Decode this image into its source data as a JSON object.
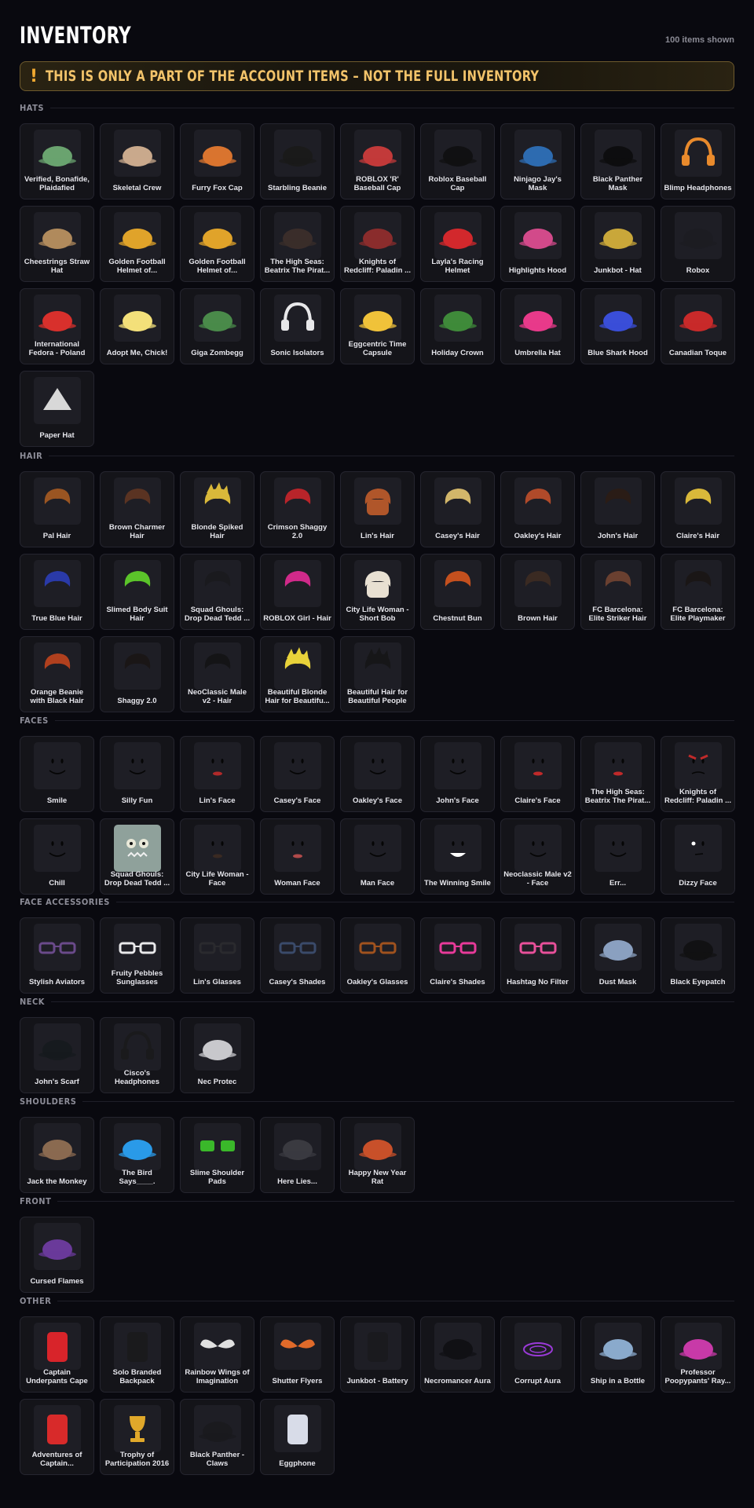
{
  "page": {
    "title": "INVENTORY",
    "items_count": "100 items shown"
  },
  "banner": {
    "icon": "exclamation-icon",
    "icon_glyph": "!",
    "text": "THIS IS ONLY A PART OF THE ACCOUNT ITEMS – NOT THE FULL INVENTORY"
  },
  "colors": {
    "background": "#09090f",
    "card": "#141419",
    "banner_border": "#6e5a2d",
    "banner_text": "#f2c36a",
    "banner_icon": "#f0a830"
  },
  "sections": [
    {
      "id": "hats",
      "title": "HATS",
      "items": [
        {
          "label": "Verified, Bonafide, Plaidafied",
          "icon": "plaid-cap-icon",
          "color": "#6aa36f"
        },
        {
          "label": "Skeletal Crew",
          "icon": "skull-icon",
          "color": "#c9a98c"
        },
        {
          "label": "Furry Fox Cap",
          "icon": "fox-cap-icon",
          "color": "#d9742f"
        },
        {
          "label": "Starbling Beanie",
          "icon": "beanie-icon",
          "color": "#1a1a1a"
        },
        {
          "label": "ROBLOX 'R' Baseball Cap",
          "icon": "cap-icon",
          "color": "#c23a3a"
        },
        {
          "label": "Roblox Baseball Cap",
          "icon": "cap-icon",
          "color": "#101012"
        },
        {
          "label": "Ninjago Jay's Mask",
          "icon": "mask-icon",
          "color": "#2d6bb0"
        },
        {
          "label": "Black Panther Mask",
          "icon": "mask-icon",
          "color": "#0d0d0f"
        },
        {
          "label": "Blimp Headphones",
          "icon": "headphones-icon",
          "color": "#e98a2c"
        },
        {
          "label": "Cheestrings Straw Hat",
          "icon": "straw-hat-icon",
          "color": "#b08a5c"
        },
        {
          "label": "Golden Football Helmet of...",
          "icon": "helmet-icon",
          "color": "#e0a32a"
        },
        {
          "label": "Golden Football Helmet of...",
          "icon": "helmet-icon",
          "color": "#e0a32a"
        },
        {
          "label": "The High Seas: Beatrix The Pirat...",
          "icon": "pirate-hat-icon",
          "color": "#3a2d2a"
        },
        {
          "label": "Knights of Redcliff: Paladin ...",
          "icon": "knight-helmet-icon",
          "color": "#8a2c2c"
        },
        {
          "label": "Layla's Racing Helmet",
          "icon": "racing-helmet-icon",
          "color": "#d2282c"
        },
        {
          "label": "Highlights Hood",
          "icon": "hood-icon",
          "color": "#d24a8a"
        },
        {
          "label": "Junkbot - Hat",
          "icon": "junkbot-hat-icon",
          "color": "#c9a73a"
        },
        {
          "label": "Robox",
          "icon": "robox-icon",
          "color": "#1c1c22"
        },
        {
          "label": "International Fedora - Poland",
          "icon": "fedora-icon",
          "color": "#d8302c"
        },
        {
          "label": "Adopt Me, Chick!",
          "icon": "chick-icon",
          "color": "#f3e07a"
        },
        {
          "label": "Giga Zombegg",
          "icon": "zombie-egg-icon",
          "color": "#4a8a4a"
        },
        {
          "label": "Sonic Isolators",
          "icon": "headphones-icon",
          "color": "#e8e8ea"
        },
        {
          "label": "Eggcentric Time Capsule",
          "icon": "egg-capsule-icon",
          "color": "#f0c23a"
        },
        {
          "label": "Holiday Crown",
          "icon": "wreath-icon",
          "color": "#3f8a3a"
        },
        {
          "label": "Umbrella Hat",
          "icon": "umbrella-hat-icon",
          "color": "#e83a8a"
        },
        {
          "label": "Blue Shark Hood",
          "icon": "shark-hood-icon",
          "color": "#3a4ed8"
        },
        {
          "label": "Canadian Toque",
          "icon": "toque-icon",
          "color": "#c82a2a"
        },
        {
          "label": "Paper Hat",
          "icon": "paper-hat-icon",
          "color": "#d8d8d8"
        }
      ]
    },
    {
      "id": "hair",
      "title": "HAIR",
      "items": [
        {
          "label": "Pal Hair",
          "icon": "hair-icon",
          "color": "#9a5522"
        },
        {
          "label": "Brown Charmer Hair",
          "icon": "hair-icon",
          "color": "#5a3322"
        },
        {
          "label": "Blonde Spiked Hair",
          "icon": "spiky-hair-icon",
          "color": "#d9b83a"
        },
        {
          "label": "Crimson Shaggy 2.0",
          "icon": "hair-icon",
          "color": "#b8242a"
        },
        {
          "label": "Lin's Hair",
          "icon": "long-hair-icon",
          "color": "#b0562a"
        },
        {
          "label": "Casey's Hair",
          "icon": "hair-icon",
          "color": "#d2b66a"
        },
        {
          "label": "Oakley's Hair",
          "icon": "hair-icon",
          "color": "#b04a2a"
        },
        {
          "label": "John's Hair",
          "icon": "hair-icon",
          "color": "#2a1c16"
        },
        {
          "label": "Claire's Hair",
          "icon": "ponytail-hair-icon",
          "color": "#d9b83a"
        },
        {
          "label": "True Blue Hair",
          "icon": "hair-icon",
          "color": "#2a3aa8"
        },
        {
          "label": "Slimed Body Suit Hair",
          "icon": "slime-hair-icon",
          "color": "#5bc42a"
        },
        {
          "label": "Squad Ghouls: Drop Dead Tedd ...",
          "icon": "hair-icon",
          "color": "#1a1a1e"
        },
        {
          "label": "ROBLOX Girl - Hair",
          "icon": "pigtail-hair-icon",
          "color": "#d02a8a"
        },
        {
          "label": "City Life Woman - Short Bob",
          "icon": "bob-hair-icon",
          "color": "#e8e0d2"
        },
        {
          "label": "Chestnut Bun",
          "icon": "bun-hair-icon",
          "color": "#c4501e"
        },
        {
          "label": "Brown Hair",
          "icon": "hair-icon",
          "color": "#3a2a22"
        },
        {
          "label": "FC Barcelona: Elite Striker Hair",
          "icon": "hair-icon",
          "color": "#6a4030"
        },
        {
          "label": "FC Barcelona: Elite Playmaker Hair",
          "icon": "hair-icon",
          "color": "#1a1616"
        },
        {
          "label": "Orange Beanie with Black Hair",
          "icon": "beanie-hair-icon",
          "color": "#b0401e"
        },
        {
          "label": "Shaggy 2.0",
          "icon": "hair-icon",
          "color": "#1a1616"
        },
        {
          "label": "NeoClassic Male v2 - Hair",
          "icon": "hair-icon",
          "color": "#141416"
        },
        {
          "label": "Beautiful Blonde Hair for Beautifu...",
          "icon": "spiky-hair-icon",
          "color": "#e8d23a"
        },
        {
          "label": "Beautiful Hair for Beautiful People",
          "icon": "spiky-hair-icon",
          "color": "#161618"
        }
      ]
    },
    {
      "id": "faces",
      "title": "FACES",
      "items": [
        {
          "label": "Smile",
          "icon": "smile-face-icon",
          "color": "#0a0a0a"
        },
        {
          "label": "Silly Fun",
          "icon": "silly-face-icon",
          "color": "#0a0a0a"
        },
        {
          "label": "Lin's Face",
          "icon": "lips-face-icon",
          "color": "#b02a2a"
        },
        {
          "label": "Casey's Face",
          "icon": "smirk-face-icon",
          "color": "#0a0a0a"
        },
        {
          "label": "Oakley's Face",
          "icon": "smirk-face-icon",
          "color": "#0a0a0a"
        },
        {
          "label": "John's Face",
          "icon": "smirk-face-icon",
          "color": "#0a0a0a"
        },
        {
          "label": "Claire's Face",
          "icon": "lips-face-icon",
          "color": "#c02a2a"
        },
        {
          "label": "The High Seas: Beatrix The Pirat...",
          "icon": "lips-face-icon",
          "color": "#c02a2a"
        },
        {
          "label": "Knights of Redcliff: Paladin ...",
          "icon": "angry-face-icon",
          "color": "#c02a2a"
        },
        {
          "label": "Chill",
          "icon": "chill-face-icon",
          "color": "#0a0a0a"
        },
        {
          "label": "Squad Ghouls: Drop Dead Tedd ...",
          "icon": "ghoul-face-icon",
          "color": "#2a3a2a"
        },
        {
          "label": "City Life Woman - Face",
          "icon": "woman-face-icon",
          "color": "#3a2a22"
        },
        {
          "label": "Woman Face",
          "icon": "woman-face-icon",
          "color": "#b04a4a"
        },
        {
          "label": "Man Face",
          "icon": "man-face-icon",
          "color": "#0a0a0a"
        },
        {
          "label": "The Winning Smile",
          "icon": "grin-face-icon",
          "color": "#ffffff"
        },
        {
          "label": "Neoclassic Male v2 - Face",
          "icon": "man-face-icon",
          "color": "#3a2a1a"
        },
        {
          "label": "Err...",
          "icon": "err-face-icon",
          "color": "#0a0a0a"
        },
        {
          "label": "Dizzy Face",
          "icon": "dizzy-face-icon",
          "color": "#ffffff"
        }
      ]
    },
    {
      "id": "face_accessories",
      "title": "FACE ACCESSORIES",
      "items": [
        {
          "label": "Stylish Aviators",
          "icon": "aviator-glasses-icon",
          "color": "#6a4a8a"
        },
        {
          "label": "Fruity Pebbles Sunglasses",
          "icon": "sunglasses-icon",
          "color": "#e8e8ea"
        },
        {
          "label": "Lin's Glasses",
          "icon": "glasses-icon",
          "color": "#2a2a2e"
        },
        {
          "label": "Casey's Shades",
          "icon": "sunglasses-icon",
          "color": "#3a4a6a"
        },
        {
          "label": "Oakley's Glasses",
          "icon": "glasses-icon",
          "color": "#a0521e"
        },
        {
          "label": "Claire's Shades",
          "icon": "sunglasses-icon",
          "color": "#e83a9a"
        },
        {
          "label": "Hashtag No Filter",
          "icon": "visor-glasses-icon",
          "color": "#e8509a"
        },
        {
          "label": "Dust Mask",
          "icon": "dust-mask-icon",
          "color": "#8aa0c0"
        },
        {
          "label": "Black Eyepatch",
          "icon": "eyepatch-icon",
          "color": "#111113"
        }
      ]
    },
    {
      "id": "neck",
      "title": "NECK",
      "items": [
        {
          "label": "John's Scarf",
          "icon": "scarf-icon",
          "color": "#161a1e"
        },
        {
          "label": "Cisco's Headphones",
          "icon": "headphones-icon",
          "color": "#1a1a1c"
        },
        {
          "label": "Nec Protec",
          "icon": "neck-pillow-icon",
          "color": "#c8c8cc"
        }
      ]
    },
    {
      "id": "shoulders",
      "title": "SHOULDERS",
      "items": [
        {
          "label": "Jack the Monkey",
          "icon": "monkey-icon",
          "color": "#8a6a50"
        },
        {
          "label": "The Bird Says____.",
          "icon": "bird-icon",
          "color": "#2a9ae8"
        },
        {
          "label": "Slime Shoulder Pads",
          "icon": "slime-pads-icon",
          "color": "#3ab82a"
        },
        {
          "label": "Here Lies...",
          "icon": "tombstone-icon",
          "color": "#3a3a40"
        },
        {
          "label": "Happy New Year Rat",
          "icon": "rat-icon",
          "color": "#c8502a"
        }
      ]
    },
    {
      "id": "front",
      "title": "FRONT",
      "items": [
        {
          "label": "Cursed Flames",
          "icon": "flames-icon",
          "color": "#6a3a9a"
        }
      ]
    },
    {
      "id": "other",
      "title": "OTHER",
      "items": [
        {
          "label": "Captain Underpants Cape",
          "icon": "cape-icon",
          "color": "#d8242a"
        },
        {
          "label": "Solo Branded Backpack",
          "icon": "backpack-icon",
          "color": "#1a1a1c"
        },
        {
          "label": "Rainbow Wings of Imagination",
          "icon": "wings-icon",
          "color": "#e0e0e0"
        },
        {
          "label": "Shutter Flyers",
          "icon": "butterfly-icon",
          "color": "#e06a2a"
        },
        {
          "label": "Junkbot - Battery",
          "icon": "battery-icon",
          "color": "#1a1a1e"
        },
        {
          "label": "Necromancer Aura",
          "icon": "aura-icon",
          "color": "#101014"
        },
        {
          "label": "Corrupt Aura",
          "icon": "aura-ring-icon",
          "color": "#9a3ad8"
        },
        {
          "label": "Ship in a Bottle",
          "icon": "bottle-icon",
          "color": "#8aaacc"
        },
        {
          "label": "Professor Poopypants' Ray...",
          "icon": "ray-gun-icon",
          "color": "#c83aa8"
        },
        {
          "label": "Adventures of Captain...",
          "icon": "book-icon",
          "color": "#d82a2a"
        },
        {
          "label": "Trophy of Participation 2016",
          "icon": "trophy-icon",
          "color": "#e0a82a"
        },
        {
          "label": "Black Panther - Claws",
          "icon": "claws-icon",
          "color": "#1a1a1e"
        },
        {
          "label": "Eggphone",
          "icon": "phone-icon",
          "color": "#d8dce8"
        }
      ]
    }
  ]
}
